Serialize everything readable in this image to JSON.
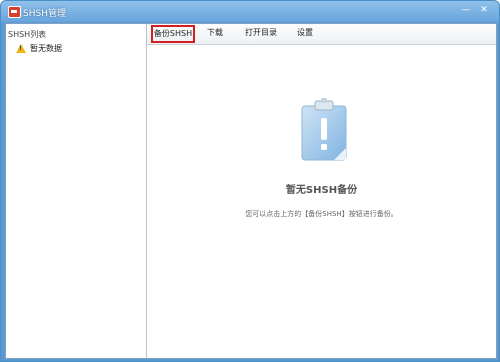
{
  "window": {
    "title": "SHSH管理",
    "minimize_glyph": "—",
    "close_glyph": "✕"
  },
  "sidebar": {
    "header": "SHSH列表",
    "items": [
      {
        "label": "暂无数据",
        "icon": "warning-icon"
      }
    ]
  },
  "toolbar": {
    "backup_label": "备份SHSH",
    "download_label": "下载",
    "open_dir_label": "打开目录",
    "settings_label": "设置"
  },
  "empty_state": {
    "icon": "clipboard-exclamation-icon",
    "title": "暂无SHSH备份",
    "hint": "您可以点击上方的【备份SHSH】按钮进行备份。"
  },
  "colors": {
    "titlebar": "#6aa6dc",
    "highlight_border": "#d21f1f",
    "icon_blue": "#7fb3e0"
  }
}
